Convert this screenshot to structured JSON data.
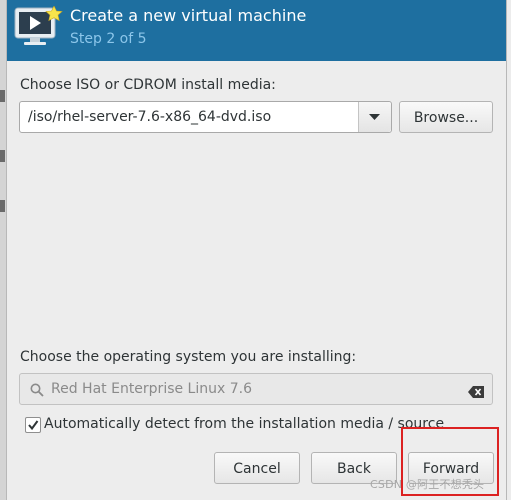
{
  "header": {
    "icon": "virtual-machine-new-icon",
    "title": "Create a new virtual machine",
    "subtitle": "Step 2 of 5",
    "color": "#1e6fa0"
  },
  "media": {
    "label": "Choose ISO or CDROM install media:",
    "value": "/iso/rhel-server-7.6-x86_64-dvd.iso",
    "dropdown_icon": "chevron-down-icon",
    "browse_label": "Browse..."
  },
  "os": {
    "label": "Choose the operating system you are installing:",
    "value": "Red Hat Enterprise Linux 7.6",
    "search_icon": "search-icon",
    "clear_icon": "clear-icon"
  },
  "auto_detect": {
    "checked": true,
    "label": "Automatically detect from the installation media / source"
  },
  "buttons": {
    "cancel": "Cancel",
    "back": "Back",
    "forward": "Forward"
  },
  "annotation": {
    "highlight_color": "#dc2222"
  },
  "watermark": "CSDN @阿王不想秃头"
}
